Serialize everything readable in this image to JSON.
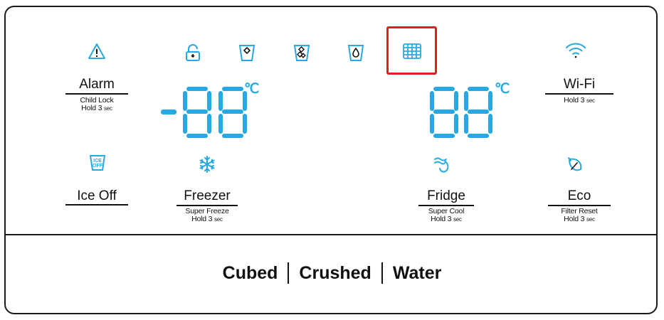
{
  "colors": {
    "accent": "#27a8e0",
    "highlight": "#e02020",
    "line": "#111111"
  },
  "left_controls": {
    "alarm": {
      "label": "Alarm",
      "sub1": "Child Lock",
      "sub2": "Hold 3",
      "sub2_unit": "sec",
      "icon": "alarm-warning-icon"
    },
    "ice_off": {
      "label": "Ice Off",
      "icon": "ice-off-icon",
      "icon_text1": "ICE",
      "icon_text2": "OFF"
    },
    "freezer": {
      "label": "Freezer",
      "sub1": "Super Freeze",
      "sub2": "Hold 3",
      "sub2_unit": "sec",
      "icon": "snowflake-icon"
    }
  },
  "right_controls": {
    "wifi": {
      "label": "Wi-Fi",
      "sub1": "Hold 3",
      "sub1_unit": "sec",
      "icon": "wifi-icon"
    },
    "fridge": {
      "label": "Fridge",
      "sub1": "Super Cool",
      "sub2": "Hold 3",
      "sub2_unit": "sec",
      "icon": "super-cool-icon"
    },
    "eco": {
      "label": "Eco",
      "sub1": "Filter Reset",
      "sub2": "Hold 3",
      "sub2_unit": "sec",
      "icon": "eco-leaf-icon"
    }
  },
  "status_icons": [
    "lock-icon",
    "cubed-ice-icon",
    "crushed-ice-icon",
    "water-drop-icon",
    "filter-grid-icon"
  ],
  "freezer_display": {
    "value": "-88",
    "unit": "℃"
  },
  "fridge_display": {
    "value": "88",
    "unit": "℃"
  },
  "dispenser": {
    "options": [
      "Cubed",
      "Crushed",
      "Water"
    ]
  }
}
